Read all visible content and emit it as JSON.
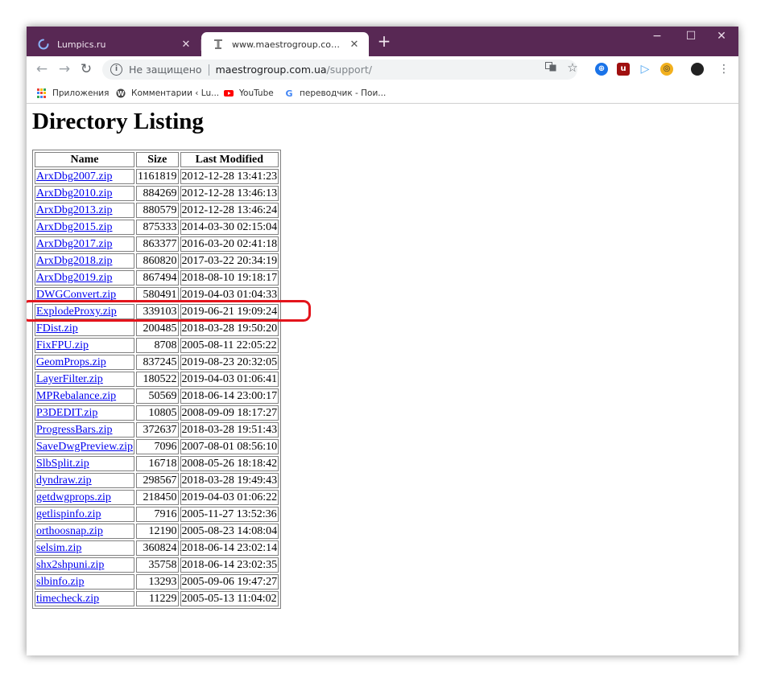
{
  "browser": {
    "tabs": [
      {
        "title": "Lumpics.ru",
        "active": false
      },
      {
        "title": "www.maestrogroup.com.ua/support/",
        "active": true
      }
    ],
    "new_tab_label": "+",
    "window_controls": {
      "minimize": "−",
      "maximize": "☐",
      "close": "✕"
    },
    "address_bar": {
      "security_label": "Не защищено",
      "host": "maestrogroup.com.ua",
      "path": "/support/"
    },
    "bookmarks": [
      {
        "label": "Приложения",
        "icon": "apps-grid-icon"
      },
      {
        "label": "Комментарии ‹ Lu...",
        "icon": "wordpress-icon"
      },
      {
        "label": "YouTube",
        "icon": "youtube-icon"
      },
      {
        "label": "переводчик - Пои...",
        "icon": "google-icon"
      }
    ],
    "colors": {
      "titlebar": "#582854",
      "link": "#0000ee",
      "highlight": "#e3141c"
    }
  },
  "page": {
    "heading": "Directory Listing",
    "columns": [
      "Name",
      "Size",
      "Last Modified"
    ],
    "rows": [
      {
        "name": "ArxDbg2007.zip",
        "size": "1161819",
        "modified": "2012-12-28 13:41:23"
      },
      {
        "name": "ArxDbg2010.zip",
        "size": "884269",
        "modified": "2012-12-28 13:46:13"
      },
      {
        "name": "ArxDbg2013.zip",
        "size": "880579",
        "modified": "2012-12-28 13:46:24"
      },
      {
        "name": "ArxDbg2015.zip",
        "size": "875333",
        "modified": "2014-03-30 02:15:04"
      },
      {
        "name": "ArxDbg2017.zip",
        "size": "863377",
        "modified": "2016-03-20 02:41:18"
      },
      {
        "name": "ArxDbg2018.zip",
        "size": "860820",
        "modified": "2017-03-22 20:34:19"
      },
      {
        "name": "ArxDbg2019.zip",
        "size": "867494",
        "modified": "2018-08-10 19:18:17"
      },
      {
        "name": "DWGConvert.zip",
        "size": "580491",
        "modified": "2019-04-03 01:04:33"
      },
      {
        "name": "ExplodeProxy.zip",
        "size": "339103",
        "modified": "2019-06-21 19:09:24",
        "highlighted": true
      },
      {
        "name": "FDist.zip",
        "size": "200485",
        "modified": "2018-03-28 19:50:20"
      },
      {
        "name": "FixFPU.zip",
        "size": "8708",
        "modified": "2005-08-11 22:05:22"
      },
      {
        "name": "GeomProps.zip",
        "size": "837245",
        "modified": "2019-08-23 20:32:05"
      },
      {
        "name": "LayerFilter.zip",
        "size": "180522",
        "modified": "2019-04-03 01:06:41"
      },
      {
        "name": "MPRebalance.zip",
        "size": "50569",
        "modified": "2018-06-14 23:00:17"
      },
      {
        "name": "P3DEDIT.zip",
        "size": "10805",
        "modified": "2008-09-09 18:17:27"
      },
      {
        "name": "ProgressBars.zip",
        "size": "372637",
        "modified": "2018-03-28 19:51:43"
      },
      {
        "name": "SaveDwgPreview.zip",
        "size": "7096",
        "modified": "2007-08-01 08:56:10"
      },
      {
        "name": "SlbSplit.zip",
        "size": "16718",
        "modified": "2008-05-26 18:18:42"
      },
      {
        "name": "dyndraw.zip",
        "size": "298567",
        "modified": "2018-03-28 19:49:43"
      },
      {
        "name": "getdwgprops.zip",
        "size": "218450",
        "modified": "2019-04-03 01:06:22"
      },
      {
        "name": "getlispinfo.zip",
        "size": "7916",
        "modified": "2005-11-27 13:52:36"
      },
      {
        "name": "orthoosnap.zip",
        "size": "12190",
        "modified": "2005-08-23 14:08:04"
      },
      {
        "name": "selsim.zip",
        "size": "360824",
        "modified": "2018-06-14 23:02:14"
      },
      {
        "name": "shx2shpuni.zip",
        "size": "35758",
        "modified": "2018-06-14 23:02:35"
      },
      {
        "name": "slbinfo.zip",
        "size": "13293",
        "modified": "2005-09-06 19:47:27"
      },
      {
        "name": "timecheck.zip",
        "size": "11229",
        "modified": "2005-05-13 11:04:02"
      }
    ]
  }
}
